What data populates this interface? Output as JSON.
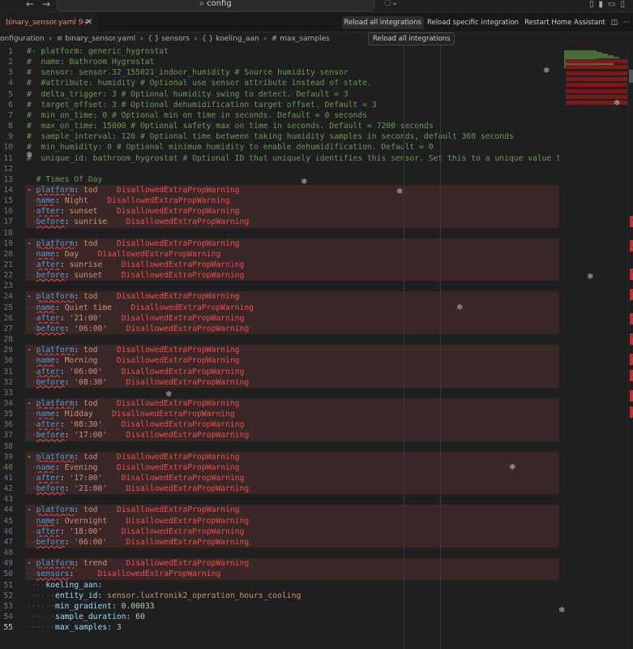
{
  "titlebar": {
    "search": "config"
  },
  "tab": {
    "label": "binary_sensor.yaml 9+"
  },
  "actions": [
    "Reload all integrations",
    "Reload specific integration",
    "Restart Home Assistant"
  ],
  "tooltip": "Reload all integrations",
  "breadcrumb": [
    "onfiguration",
    "binary_sensor.yaml",
    "{ } sensors",
    "{ } koeling_aan",
    "# max_samples"
  ],
  "lines": [
    {
      "n": 1,
      "comment": "#- platform: generic_hygrostat"
    },
    {
      "n": 2,
      "comment": "#  name: Bathroom Hygrostat"
    },
    {
      "n": 3,
      "comment": "#  sensor: sensor.32_155021_indoor_humidity # Source humidity sensor"
    },
    {
      "n": 4,
      "comment": "#  #attribute: humidity # Optional use sensor attribute instead of state."
    },
    {
      "n": 5,
      "comment": "#  delta_trigger: 3 # Optional humidity swing to detect. Default = 3"
    },
    {
      "n": 6,
      "comment": "#  target_offset: 3 # Optional dehumidification target offset. Default = 3"
    },
    {
      "n": 7,
      "comment": "#  min_on_time: 0 # Optional min on time in seconds. Default = 0 seconds"
    },
    {
      "n": 8,
      "comment": "#  max_on_time: 15000 # Optional safety max on time in seconds. Default = 7200 seconds"
    },
    {
      "n": 9,
      "comment": "#  sample_interval: 120 # Optional time between taking humidity samples in seconds, default 300 seconds"
    },
    {
      "n": 10,
      "comment": "#  min_humidity: 0 # Optional minimum humidity to enable dehumidification. Default = 0"
    },
    {
      "n": 11,
      "comment": "#  unique_id: bathroom_hygrostat # Optional ID that uniquely identifies this sensor. Set this to a unique value to"
    },
    {
      "n": 12
    },
    {
      "n": 13,
      "comment": "  # Times Of Day"
    },
    {
      "n": 14,
      "dash": true,
      "key": "platform",
      "val": "tod",
      "warn": "DisallowedExtraPropWarning"
    },
    {
      "n": 15,
      "key": "name",
      "val": "Night",
      "warn": "DisallowedExtraPropWarning"
    },
    {
      "n": 16,
      "key": "after",
      "val": "sunset",
      "warn": "DisallowedExtraPropWarning"
    },
    {
      "n": 17,
      "key": "before",
      "val": "sunrise",
      "warn": "DisallowedExtraPropWarning"
    },
    {
      "n": 18
    },
    {
      "n": 19,
      "dash": true,
      "key": "platform",
      "val": "tod",
      "warn": "DisallowedExtraPropWarning"
    },
    {
      "n": 20,
      "key": "name",
      "val": "Day",
      "warn": "DisallowedExtraPropWarning"
    },
    {
      "n": 21,
      "key": "after",
      "val": "sunrise",
      "warn": "DisallowedExtraPropWarning"
    },
    {
      "n": 22,
      "key": "before",
      "val": "sunset",
      "warn": "DisallowedExtraPropWarning"
    },
    {
      "n": 23
    },
    {
      "n": 24,
      "dash": true,
      "key": "platform",
      "val": "tod",
      "warn": "DisallowedExtraPropWarning"
    },
    {
      "n": 25,
      "key": "name",
      "val": "Quiet time",
      "warn": "DisallowedExtraPropWarning"
    },
    {
      "n": 26,
      "key": "after",
      "val": "'21:00'",
      "warn": "DisallowedExtraPropWarning"
    },
    {
      "n": 27,
      "key": "before",
      "val": "'06:00'",
      "warn": "DisallowedExtraPropWarning"
    },
    {
      "n": 28
    },
    {
      "n": 29,
      "dash": true,
      "key": "platform",
      "val": "tod",
      "warn": "DisallowedExtraPropWarning"
    },
    {
      "n": 30,
      "key": "name",
      "val": "Morning",
      "warn": "DisallowedExtraPropWarning"
    },
    {
      "n": 31,
      "key": "after",
      "val": "'06:00'",
      "warn": "DisallowedExtraPropWarning"
    },
    {
      "n": 32,
      "key": "before",
      "val": "'08:30'",
      "warn": "DisallowedExtraPropWarning"
    },
    {
      "n": 33
    },
    {
      "n": 34,
      "dash": true,
      "key": "platform",
      "val": "tod",
      "warn": "DisallowedExtraPropWarning"
    },
    {
      "n": 35,
      "key": "name",
      "val": "Midday",
      "warn": "DisallowedExtraPropWarning"
    },
    {
      "n": 36,
      "key": "after",
      "val": "'08:30'",
      "warn": "DisallowedExtraPropWarning"
    },
    {
      "n": 37,
      "key": "before",
      "val": "'17:00'",
      "warn": "DisallowedExtraPropWarning"
    },
    {
      "n": 38
    },
    {
      "n": 39,
      "dash": true,
      "key": "platform",
      "val": "tod",
      "warn": "DisallowedExtraPropWarning"
    },
    {
      "n": 40,
      "key": "name",
      "val": "Evening",
      "warn": "DisallowedExtraPropWarning"
    },
    {
      "n": 41,
      "key": "after",
      "val": "'17:00'",
      "warn": "DisallowedExtraPropWarning"
    },
    {
      "n": 42,
      "key": "before",
      "val": "'21:00'",
      "warn": "DisallowedExtraPropWarning"
    },
    {
      "n": 43
    },
    {
      "n": 44,
      "dash": true,
      "key": "platform",
      "val": "tod",
      "warn": "DisallowedExtraPropWarning"
    },
    {
      "n": 45,
      "key": "name",
      "val": "Overnight",
      "warn": "DisallowedExtraPropWarning"
    },
    {
      "n": 46,
      "key": "after",
      "val": "'18:00'",
      "warn": "DisallowedExtraPropWarning"
    },
    {
      "n": 47,
      "key": "before",
      "val": "'06:00'",
      "warn": "DisallowedExtraPropWarning"
    },
    {
      "n": 48
    },
    {
      "n": 49,
      "dash": true,
      "key": "platform",
      "val": "trend",
      "warn": "DisallowedExtraPropWarning"
    },
    {
      "n": 50,
      "key": "sensors",
      "val": "",
      "warn": "DisallowedExtraPropWarning"
    },
    {
      "n": 51,
      "indent": 2,
      "key2": "koeling_aan",
      "val": ""
    },
    {
      "n": 52,
      "indent": 3,
      "key2": "entity_id",
      "val": "sensor.luxtronik2_operation_hours_cooling"
    },
    {
      "n": 53,
      "indent": 3,
      "key2": "min_gradient",
      "num": "0.00033"
    },
    {
      "n": 54,
      "indent": 3,
      "key2": "sample_duration",
      "num": "60"
    },
    {
      "n": 55,
      "indent": 3,
      "key2": "max_samples",
      "num": "3",
      "current": true
    }
  ]
}
